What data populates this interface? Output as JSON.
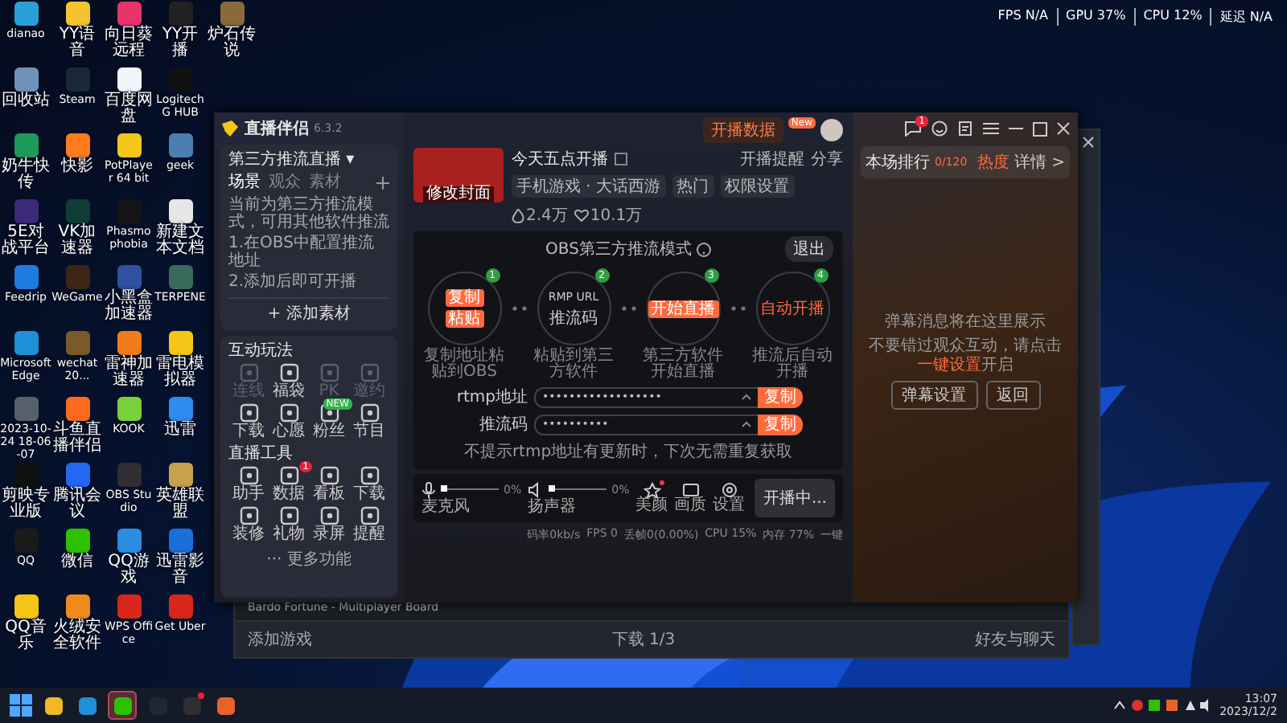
{
  "desktop": {
    "icon_columns": [
      [
        {
          "label": "dianao",
          "color": "#2a9fd8"
        },
        {
          "label": "回收站",
          "color": "#6f93b8"
        },
        {
          "label": "奶牛快传",
          "color": "#1f9a5a"
        },
        {
          "label": "5E对战平台",
          "color": "#3a2a78"
        },
        {
          "label": "Feedrip",
          "color": "#1e7be0"
        },
        {
          "label": "Microsoft Edge",
          "color": "#1f8fd6"
        },
        {
          "label": "2023-10-24 18-06-07",
          "color": "#55606a"
        },
        {
          "label": "剪映专业版",
          "color": "#101010"
        },
        {
          "label": "QQ",
          "color": "#1a1a1a"
        },
        {
          "label": "QQ音乐",
          "color": "#f5c518"
        }
      ],
      [
        {
          "label": "YY语音",
          "color": "#f4c430"
        },
        {
          "label": "Steam",
          "color": "#1b2838"
        },
        {
          "label": "快影",
          "color": "#ff7a1a"
        },
        {
          "label": "VK加速器",
          "color": "#0f3d38"
        },
        {
          "label": "WeGame",
          "color": "#3b2616"
        },
        {
          "label": "wechat 20...",
          "color": "#7a5a2a"
        },
        {
          "label": "斗鱼直播伴侣",
          "color": "#ff6a1f"
        },
        {
          "label": "腾讯会议",
          "color": "#2468f2"
        },
        {
          "label": "微信",
          "color": "#2dc100"
        },
        {
          "label": "火绒安全软件",
          "color": "#f08a1c"
        }
      ],
      [
        {
          "label": "向日葵远程",
          "color": "#e8336b"
        },
        {
          "label": "百度网盘",
          "color": "#f2f5fa"
        },
        {
          "label": "PotPlayer 64 bit",
          "color": "#f2c81a"
        },
        {
          "label": "Phasmophobia",
          "color": "#151515"
        },
        {
          "label": "小黑盒加速器",
          "color": "#3050a0"
        },
        {
          "label": "雷神加速器",
          "color": "#f07d1a"
        },
        {
          "label": "KOOK",
          "color": "#7ad03a"
        },
        {
          "label": "OBS Studio",
          "color": "#302e31"
        },
        {
          "label": "QQ游戏",
          "color": "#2b8de0"
        },
        {
          "label": "WPS Office",
          "color": "#d9261c"
        }
      ],
      [
        {
          "label": "YY开播",
          "color": "#222222"
        },
        {
          "label": "Logitech G HUB",
          "color": "#111111"
        },
        {
          "label": "geek",
          "color": "#4a7fb0"
        },
        {
          "label": "新建文本文档",
          "color": "#e6e6e6"
        },
        {
          "label": "TERPENE",
          "color": "#3a6a5a"
        },
        {
          "label": "雷电模拟器",
          "color": "#f5c518"
        },
        {
          "label": "迅雷",
          "color": "#2f8bf0"
        },
        {
          "label": "英雄联盟",
          "color": "#c8a24a"
        },
        {
          "label": "迅雷影音",
          "color": "#1c6ed8"
        },
        {
          "label": "Get Uber",
          "color": "#d9261c"
        }
      ],
      [
        {
          "label": "炉石传说",
          "color": "#8a6a3a"
        }
      ]
    ]
  },
  "overlay_stats": [
    "FPS N/A",
    "GPU 37%",
    "CPU 12%",
    "延迟 N/A"
  ],
  "back_window": {
    "list_item": "Bardo Fortune - Multiplayer Board",
    "footer": [
      "添加游戏",
      "下载 1/3",
      "好友与聊天"
    ]
  },
  "app": {
    "brand": {
      "name": "直播伴侣",
      "version": "6.3.2"
    },
    "scene_panel": {
      "title": "第三方推流直播 ▾",
      "tabs": [
        {
          "label": "场景",
          "selected": true
        },
        {
          "label": "观众",
          "selected": false
        },
        {
          "label": "素材",
          "selected": false
        }
      ],
      "description": "当前为第三方推流模式，可用其他软件推流",
      "steps": [
        "1.在OBS中配置推流地址",
        "2.添加后即可开播"
      ],
      "add_button": "+ 添加素材"
    },
    "interaction": {
      "title": "互动玩法",
      "tools": [
        {
          "label": "连线",
          "disabled": true
        },
        {
          "label": "福袋",
          "disabled": false
        },
        {
          "label": "PK",
          "disabled": true
        },
        {
          "label": "邀约",
          "disabled": true
        },
        {
          "label": "下载",
          "disabled": false
        },
        {
          "label": "心愿",
          "disabled": false
        },
        {
          "label": "粉丝",
          "disabled": false,
          "badge": "NEW"
        },
        {
          "label": "节目",
          "disabled": false
        }
      ]
    },
    "live_tools": {
      "title": "直播工具",
      "tools": [
        {
          "label": "助手",
          "disabled": false
        },
        {
          "label": "数据",
          "disabled": false,
          "badge": "1"
        },
        {
          "label": "看板",
          "disabled": false
        },
        {
          "label": "下载",
          "disabled": false
        },
        {
          "label": "装修",
          "disabled": false
        },
        {
          "label": "礼物",
          "disabled": false
        },
        {
          "label": "录屏",
          "disabled": false
        },
        {
          "label": "提醒",
          "disabled": false
        }
      ]
    },
    "more": "··· 更多功能",
    "header": {
      "data_button": "开播数据",
      "new_badge": "New",
      "cover_caption": "修改封面",
      "title": "今天五点开播",
      "category": "手机游戏 · 大话西游",
      "chips": [
        "热门",
        "权限设置"
      ],
      "actions": [
        "开播提醒",
        "分享"
      ],
      "stats": [
        {
          "kind": "fire",
          "value": "2.4万"
        },
        {
          "kind": "heart",
          "value": "10.1万"
        }
      ]
    },
    "obs": {
      "title": "OBS第三方推流模式",
      "exit": "退出",
      "steps": [
        {
          "number": "1",
          "kind": "buttons",
          "items": [
            "复制",
            "粘贴"
          ],
          "caption": "复制地址粘贴到OBS"
        },
        {
          "number": "2",
          "kind": "text",
          "items": [
            "RMP URL",
            "推流码"
          ],
          "caption": "粘贴到第三方软件"
        },
        {
          "number": "3",
          "kind": "buttons",
          "items": [
            "开始直播"
          ],
          "caption": "第三方软件开始直播"
        },
        {
          "number": "4",
          "kind": "accent_text",
          "items": [
            "自动开播"
          ],
          "caption": "推流后自动开播"
        }
      ],
      "fields": [
        {
          "label": "rtmp地址",
          "value": "••••••••••••••••••",
          "button": "复制"
        },
        {
          "label": "推流码",
          "value": "••••••••••",
          "button": "复制"
        }
      ],
      "note": "不提示rtmp地址有更新时，下次无需重复获取"
    },
    "controls": {
      "audio": [
        {
          "kind": "microphone",
          "label": "麦克风",
          "level": 0,
          "reading": "0%"
        },
        {
          "kind": "speaker",
          "label": "扬声器",
          "level": 0,
          "reading": "0%"
        }
      ],
      "tools": [
        {
          "kind": "beauty",
          "label": "美颜",
          "dot": true
        },
        {
          "kind": "screen",
          "label": "画质",
          "dot": false
        },
        {
          "kind": "settings",
          "label": "设置",
          "dot": false
        }
      ],
      "live_button": "开播中..."
    },
    "status": [
      "码率0kb/s",
      "FPS 0",
      "丢帧0(0.00%)",
      "CPU 15%",
      "内存 77%",
      "一键"
    ],
    "message_badge": "1",
    "rank": {
      "title": "本场排行",
      "count": "0/120",
      "heat": "热度",
      "details": "详情 >"
    },
    "chat": {
      "empty_title": "弹幕消息将在这里展示",
      "hint_before": "不要错过观众互动，请点击",
      "hint_link": "一键设置",
      "hint_after": "开启",
      "buttons": [
        "弹幕设置",
        "返回"
      ]
    }
  },
  "taskbar": {
    "apps": [
      {
        "kind": "explorer",
        "selected": false,
        "notification": false
      },
      {
        "kind": "edge",
        "selected": false,
        "notification": false
      },
      {
        "kind": "wechat",
        "selected": true,
        "notification": false
      },
      {
        "kind": "steam",
        "selected": false,
        "notification": false
      },
      {
        "kind": "obs",
        "selected": false,
        "notification": true
      },
      {
        "kind": "browser",
        "selected": false,
        "notification": false
      }
    ],
    "time": "13:07",
    "date": "2023/12/2"
  }
}
